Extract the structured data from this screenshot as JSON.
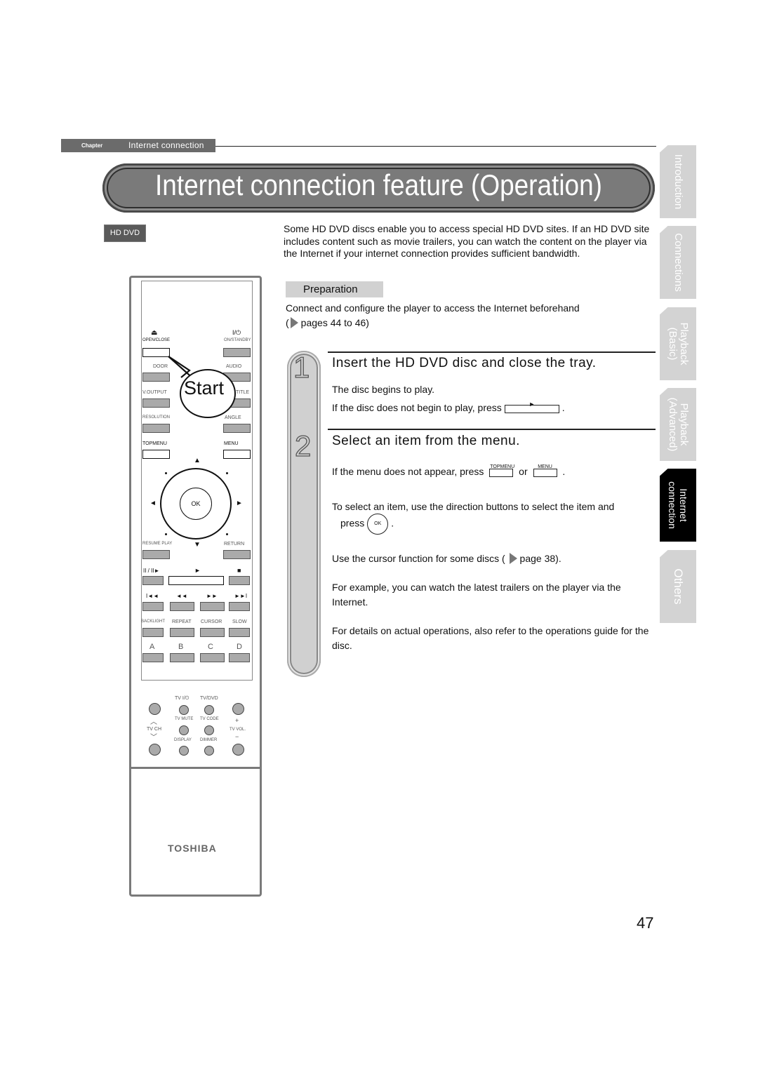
{
  "chapter": {
    "label": "Chapter",
    "name": "Internet connection"
  },
  "title": "Internet connection feature (Operation)",
  "badge": "HD DVD",
  "side_tabs": [
    {
      "label": "Introduction",
      "active": false
    },
    {
      "label": "Connections",
      "active": false
    },
    {
      "label": "Playback\n(Basic)",
      "active": false
    },
    {
      "label": "Playback\n(Advanced)",
      "active": false
    },
    {
      "label": "Internet\nconnection",
      "active": true
    },
    {
      "label": "Others",
      "active": false
    }
  ],
  "intro": "Some HD DVD discs enable you to access special HD DVD sites. If an HD DVD site includes content such as movie trailers, you can watch the content on the player via the Internet if your internet connection provides sufficient bandwidth.",
  "preparation": {
    "heading": "Preparation",
    "text": "Connect and configure the player to access the Internet beforehand",
    "ref_open": "(",
    "ref": "pages 44 to 46)"
  },
  "steps": [
    {
      "number": "1",
      "heading": "Insert the HD DVD disc and close the tray.",
      "lines": [
        "The disc begins to play.",
        "If the disc does not begin to play, press",
        "."
      ],
      "button_caption": "►"
    },
    {
      "number": "2",
      "heading": "Select an item from the menu.",
      "bullet1_pre": "If the menu does not appear, press",
      "bullet1_btn1": "TOPMENU",
      "bullet1_or": "or",
      "bullet1_btn2": "MENU",
      "bullet1_post": ".",
      "bullet2_line1": "To select an item, use the direction buttons to select the item and",
      "bullet2_press": "press",
      "bullet2_ok": "OK",
      "bullet2_post": ".",
      "bullet3_pre": "Use the cursor function for some discs (",
      "bullet3_ref": "page 38).",
      "para1": "For example, you can watch the latest trailers on the player via the Internet.",
      "para2": "For details on actual operations, also refer to the operations guide for the disc."
    }
  ],
  "remote": {
    "callout": "Start",
    "labels": {
      "open_close_icon": "⏏",
      "open_close": "OPEN/CLOSE",
      "power_icon": "I/⏻",
      "on_standby": "ON/STANDBY",
      "door": "DOOR",
      "audio": "AUDIO",
      "voutput": "V.OUTPUT",
      "title": "TITLE",
      "resolution": "RESOLUTION",
      "angle": "ANGLE",
      "topmenu": "TOPMENU",
      "menu": "MENU",
      "ok": "OK",
      "up": "▲",
      "down": "▼",
      "left": "◄",
      "right": "►",
      "resume_play": "RESUME PLAY",
      "return": "RETURN",
      "pause_step": "II / II►",
      "play": "►",
      "stop": "■",
      "skip_back": "I◄◄",
      "rewind": "◄◄",
      "fast_forward": "►►",
      "skip_forward": "►►I",
      "backlight": "BACKLIGHT",
      "repeat": "REPEAT",
      "cursor": "CURSOR",
      "slow": "SLOW",
      "a": "A",
      "b": "B",
      "c": "C",
      "d": "D",
      "tv_power": "TV  I/⏻",
      "tv_dvd": "TV/DVD",
      "tv_mute": "TV MUTE",
      "tv_code": "TV CODE",
      "display": "DISPLAY",
      "dimmer": "DIMMER",
      "tv_ch": "TV CH",
      "tv_vol": "TV VOL.",
      "ch_up": "︿",
      "ch_down": "﹀",
      "vol_plus": "+",
      "vol_minus": "−"
    },
    "brand": "TOSHIBA"
  },
  "page_number": "47"
}
